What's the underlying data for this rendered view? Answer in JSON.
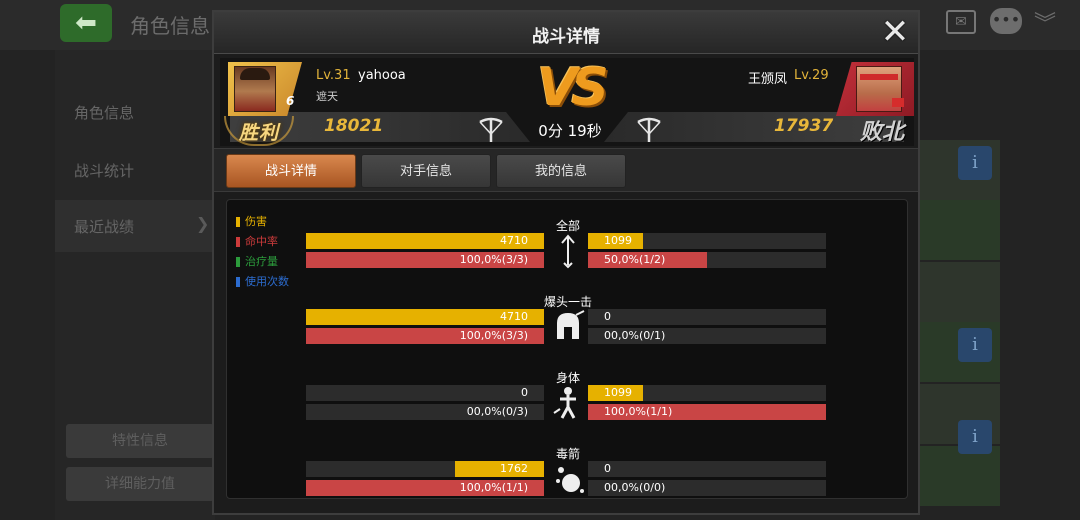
{
  "background": {
    "title": "角色信息",
    "back_icon": "arrow-left-icon",
    "sidebar": {
      "items": [
        "角色信息",
        "战斗统计",
        "最近战绩"
      ],
      "buttons": [
        "特性信息",
        "详细能力值"
      ]
    },
    "info_label": "i"
  },
  "modal": {
    "title": "战斗详情",
    "close_label": "✕"
  },
  "battle": {
    "player": {
      "level": "Lv.31",
      "name": "yahooa",
      "guild": "遮天",
      "rank": "6",
      "power": "18021",
      "result": "胜利"
    },
    "opponent": {
      "name": "王颁凤",
      "level": "Lv.29",
      "power": "17937",
      "result": "败北"
    },
    "vs_label": "VS",
    "duration": "0分 19秒"
  },
  "tabs": [
    {
      "label": "战斗详情",
      "active": true
    },
    {
      "label": "对手信息",
      "active": false
    },
    {
      "label": "我的信息",
      "active": false
    }
  ],
  "legend": [
    {
      "label": "伤害",
      "color": "#e6b100"
    },
    {
      "label": "命中率",
      "color": "#cc3b3b"
    },
    {
      "label": "治疗量",
      "color": "#2c9c3c"
    },
    {
      "label": "使用次数",
      "color": "#2c6ccf"
    }
  ],
  "colors": {
    "damage": "#e6b100",
    "hit_rate": "#c94545"
  },
  "chart_data": {
    "type": "bar",
    "series": [
      {
        "name": "伤害"
      },
      {
        "name": "命中率"
      }
    ],
    "sections": [
      {
        "title": "全部",
        "icon": "arrow-icon",
        "left_damage": {
          "text": "4710",
          "fraction": 1.0
        },
        "left_hit": {
          "text": "100,0%(3/3)",
          "fraction": 1.0
        },
        "right_damage": {
          "text": "1099",
          "fraction": 0.233
        },
        "right_hit": {
          "text": "50,0%(1/2)",
          "fraction": 0.5
        }
      },
      {
        "title": "爆头一击",
        "icon": "helmet-icon",
        "left_damage": {
          "text": "4710",
          "fraction": 1.0
        },
        "left_hit": {
          "text": "100,0%(3/3)",
          "fraction": 1.0
        },
        "right_damage": {
          "text": "0",
          "fraction": 0
        },
        "right_hit": {
          "text": "00,0%(0/1)",
          "fraction": 0
        }
      },
      {
        "title": "身体",
        "icon": "body-hit-icon",
        "left_damage": {
          "text": "0",
          "fraction": 0
        },
        "left_hit": {
          "text": "00,0%(0/3)",
          "fraction": 0
        },
        "right_damage": {
          "text": "1099",
          "fraction": 0.233
        },
        "right_hit": {
          "text": "100,0%(1/1)",
          "fraction": 1.0
        }
      },
      {
        "title": "毒箭",
        "icon": "poison-icon",
        "left_damage": {
          "text": "1762",
          "fraction": 0.374
        },
        "left_hit": {
          "text": "100,0%(1/1)",
          "fraction": 1.0
        },
        "right_damage": {
          "text": "0",
          "fraction": 0
        },
        "right_hit": {
          "text": "00,0%(0/0)",
          "fraction": 0
        }
      }
    ]
  }
}
